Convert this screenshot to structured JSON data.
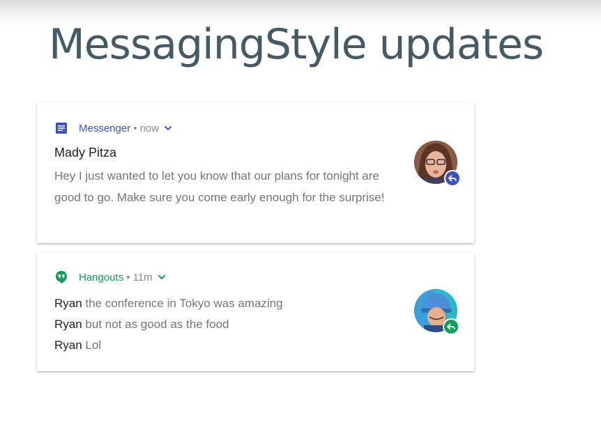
{
  "slide": {
    "title": "MessagingStyle updates"
  },
  "colors": {
    "title": "#455a64",
    "messenger": "#3f51b5",
    "hangouts": "#0f9d58"
  },
  "notifications": [
    {
      "app": "Messenger",
      "app_icon": "messenger-app-icon",
      "separator": "•",
      "time": "now",
      "title": "Mady Pitza",
      "body": "Hey I just wanted to let you know that our plans for tonight are good to go. Make sure you come early enough for the surprise!",
      "action_icon": "reply-icon"
    },
    {
      "app": "Hangouts",
      "app_icon": "hangouts-app-icon",
      "separator": "•",
      "time": "11m",
      "messages": [
        {
          "sender": "Ryan",
          "text": "the conference in Tokyo was amazing"
        },
        {
          "sender": "Ryan",
          "text": "but not as good as the food"
        },
        {
          "sender": "Ryan",
          "text": "Lol"
        }
      ],
      "action_icon": "reply-icon"
    }
  ]
}
